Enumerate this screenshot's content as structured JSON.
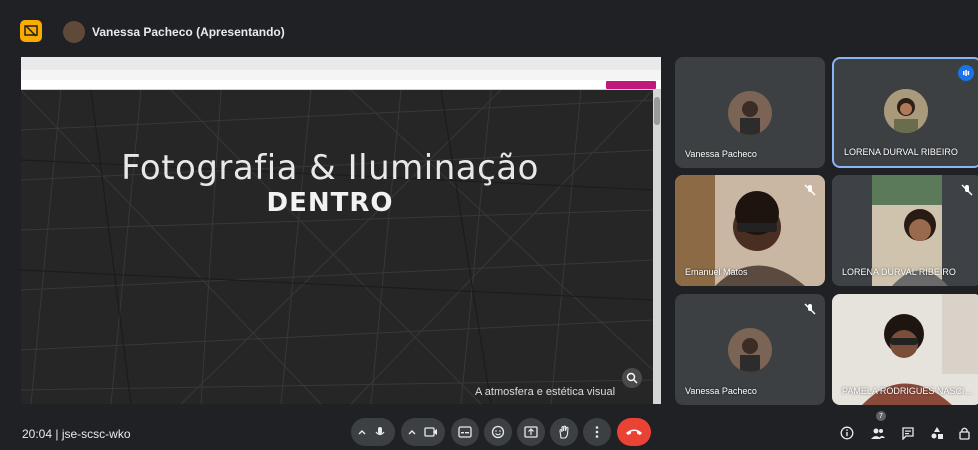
{
  "topbar": {
    "presenter_title": "Vanessa Pacheco (Apresentando)"
  },
  "slide": {
    "title": "Fotografia & Iluminação",
    "subtitle": "DENTRO",
    "caption": "A atmosfera e estética visual"
  },
  "tiles": [
    {
      "name": "Vanessa Pacheco",
      "mic_muted": false
    },
    {
      "name": "LORENA DURVAL RIBEIRO",
      "mic_muted": false,
      "speaking": true
    },
    {
      "name": "Emanuel Matos",
      "mic_muted": true
    },
    {
      "name": "LORENA DURVAL RIBEIRO",
      "mic_muted": true
    },
    {
      "name": "Vanessa Pacheco",
      "mic_muted": true
    },
    {
      "name": "PAMELA RODRIGUES NASCI...",
      "mic_muted": false
    }
  ],
  "bottombar": {
    "meeting_info": "20:04 | jse-scsc-wko",
    "people_count": "7"
  },
  "colors": {
    "background": "#202124",
    "tile": "#3c4043",
    "accent_blue": "#1a73e8",
    "hangup_red": "#ea4335",
    "present_yellow": "#f9ab00"
  }
}
